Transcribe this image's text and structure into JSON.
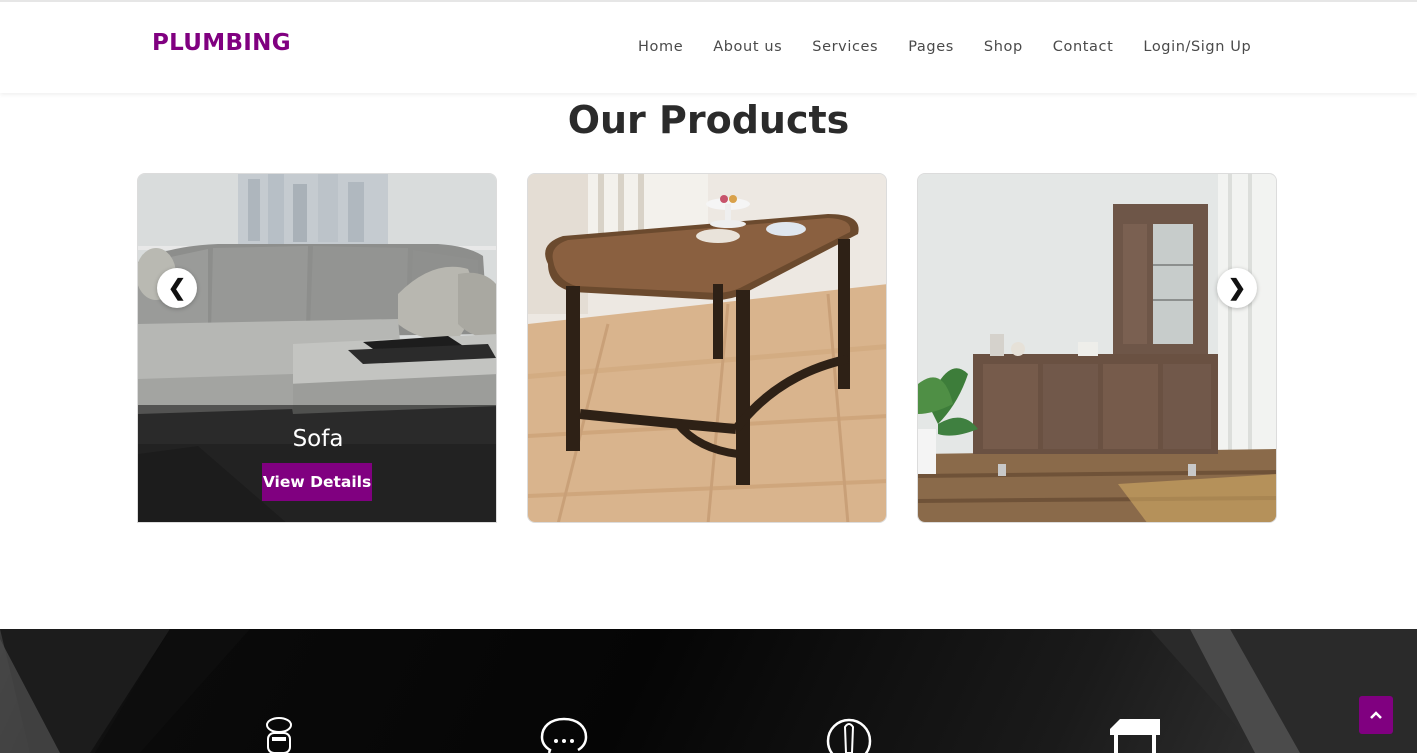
{
  "brand": {
    "logo_text": "PLUMBING",
    "accent_color": "#800080"
  },
  "nav": {
    "items": [
      {
        "label": "Home"
      },
      {
        "label": "About us"
      },
      {
        "label": "Services"
      },
      {
        "label": "Pages"
      },
      {
        "label": "Shop"
      },
      {
        "label": "Contact"
      },
      {
        "label": "Login/Sign Up"
      }
    ]
  },
  "products": {
    "title": "Our Products",
    "cards": [
      {
        "name": "Sofa",
        "button_label": "View Details",
        "image_icon": "sofa-image"
      },
      {
        "image_icon": "table-image"
      },
      {
        "image_icon": "cabinet-image"
      }
    ],
    "prev_arrow": "❮",
    "next_arrow": "❯"
  },
  "features": {
    "icons": [
      "toilet-icon",
      "chat-support-icon",
      "faucet-icon",
      "table-icon"
    ]
  },
  "scroll_top": {
    "icon": "chevron-up-icon"
  }
}
